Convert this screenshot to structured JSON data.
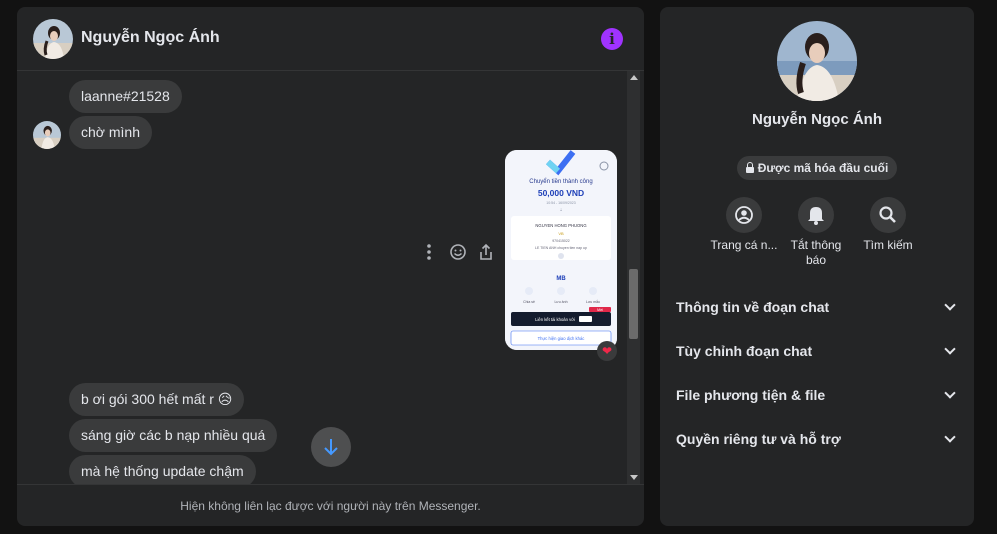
{
  "header": {
    "contact_name": "Nguyễn Ngọc Ánh",
    "info_icon": "info-icon",
    "accent_color": "#a033ff"
  },
  "messages": [
    {
      "text": "laanne#21528",
      "sender": "contact"
    },
    {
      "text": "chờ mình",
      "sender": "contact"
    },
    {
      "type": "image",
      "sender": "me",
      "reaction": "❤"
    },
    {
      "text": "b ơi gói 300 hết mất r 😥",
      "sender": "contact"
    },
    {
      "text": "sáng giờ các b nạp nhiều quá",
      "sender": "contact"
    },
    {
      "text": "mà hệ thống update chậm",
      "sender": "contact"
    }
  ],
  "image_message": {
    "title": "Chuyển tiền thành công",
    "amount": "50,000 VND",
    "datetime": "10:54 - 16/09/2023",
    "recipient": "NGUYEN HONG PHUONG",
    "bank_short": "VB",
    "account": "970415022",
    "note": "LE TIEN ANH chuyen tien nap up",
    "bank_logo": "MB",
    "share_label": "Chia sẻ",
    "save_label": "Lưu ảnh",
    "template_label": "Lưu mẫu",
    "link_banner": "Liên kết tài khoản với",
    "new_tag": "Mới",
    "cta_label": "Thực hiện giao dịch khác"
  },
  "message_actions": [
    "more-icon",
    "emoji-icon",
    "share-icon"
  ],
  "footer": {
    "notice": "Hiện không liên lạc được với người này trên Messenger."
  },
  "profile": {
    "name": "Nguyễn Ngọc Ánh",
    "encryption_badge": "Được mã hóa đầu cuối"
  },
  "actions": [
    {
      "label": "Trang cá n...",
      "icon": "profile-icon"
    },
    {
      "label": "Tắt thông\nbáo",
      "icon": "bell-icon"
    },
    {
      "label": "Tìm kiếm",
      "icon": "search-icon"
    }
  ],
  "sections": [
    {
      "label": "Thông tin về đoạn chat"
    },
    {
      "label": "Tùy chỉnh đoạn chat"
    },
    {
      "label": "File phương tiện & file"
    },
    {
      "label": "Quyền riêng tư và hỗ trợ"
    }
  ]
}
